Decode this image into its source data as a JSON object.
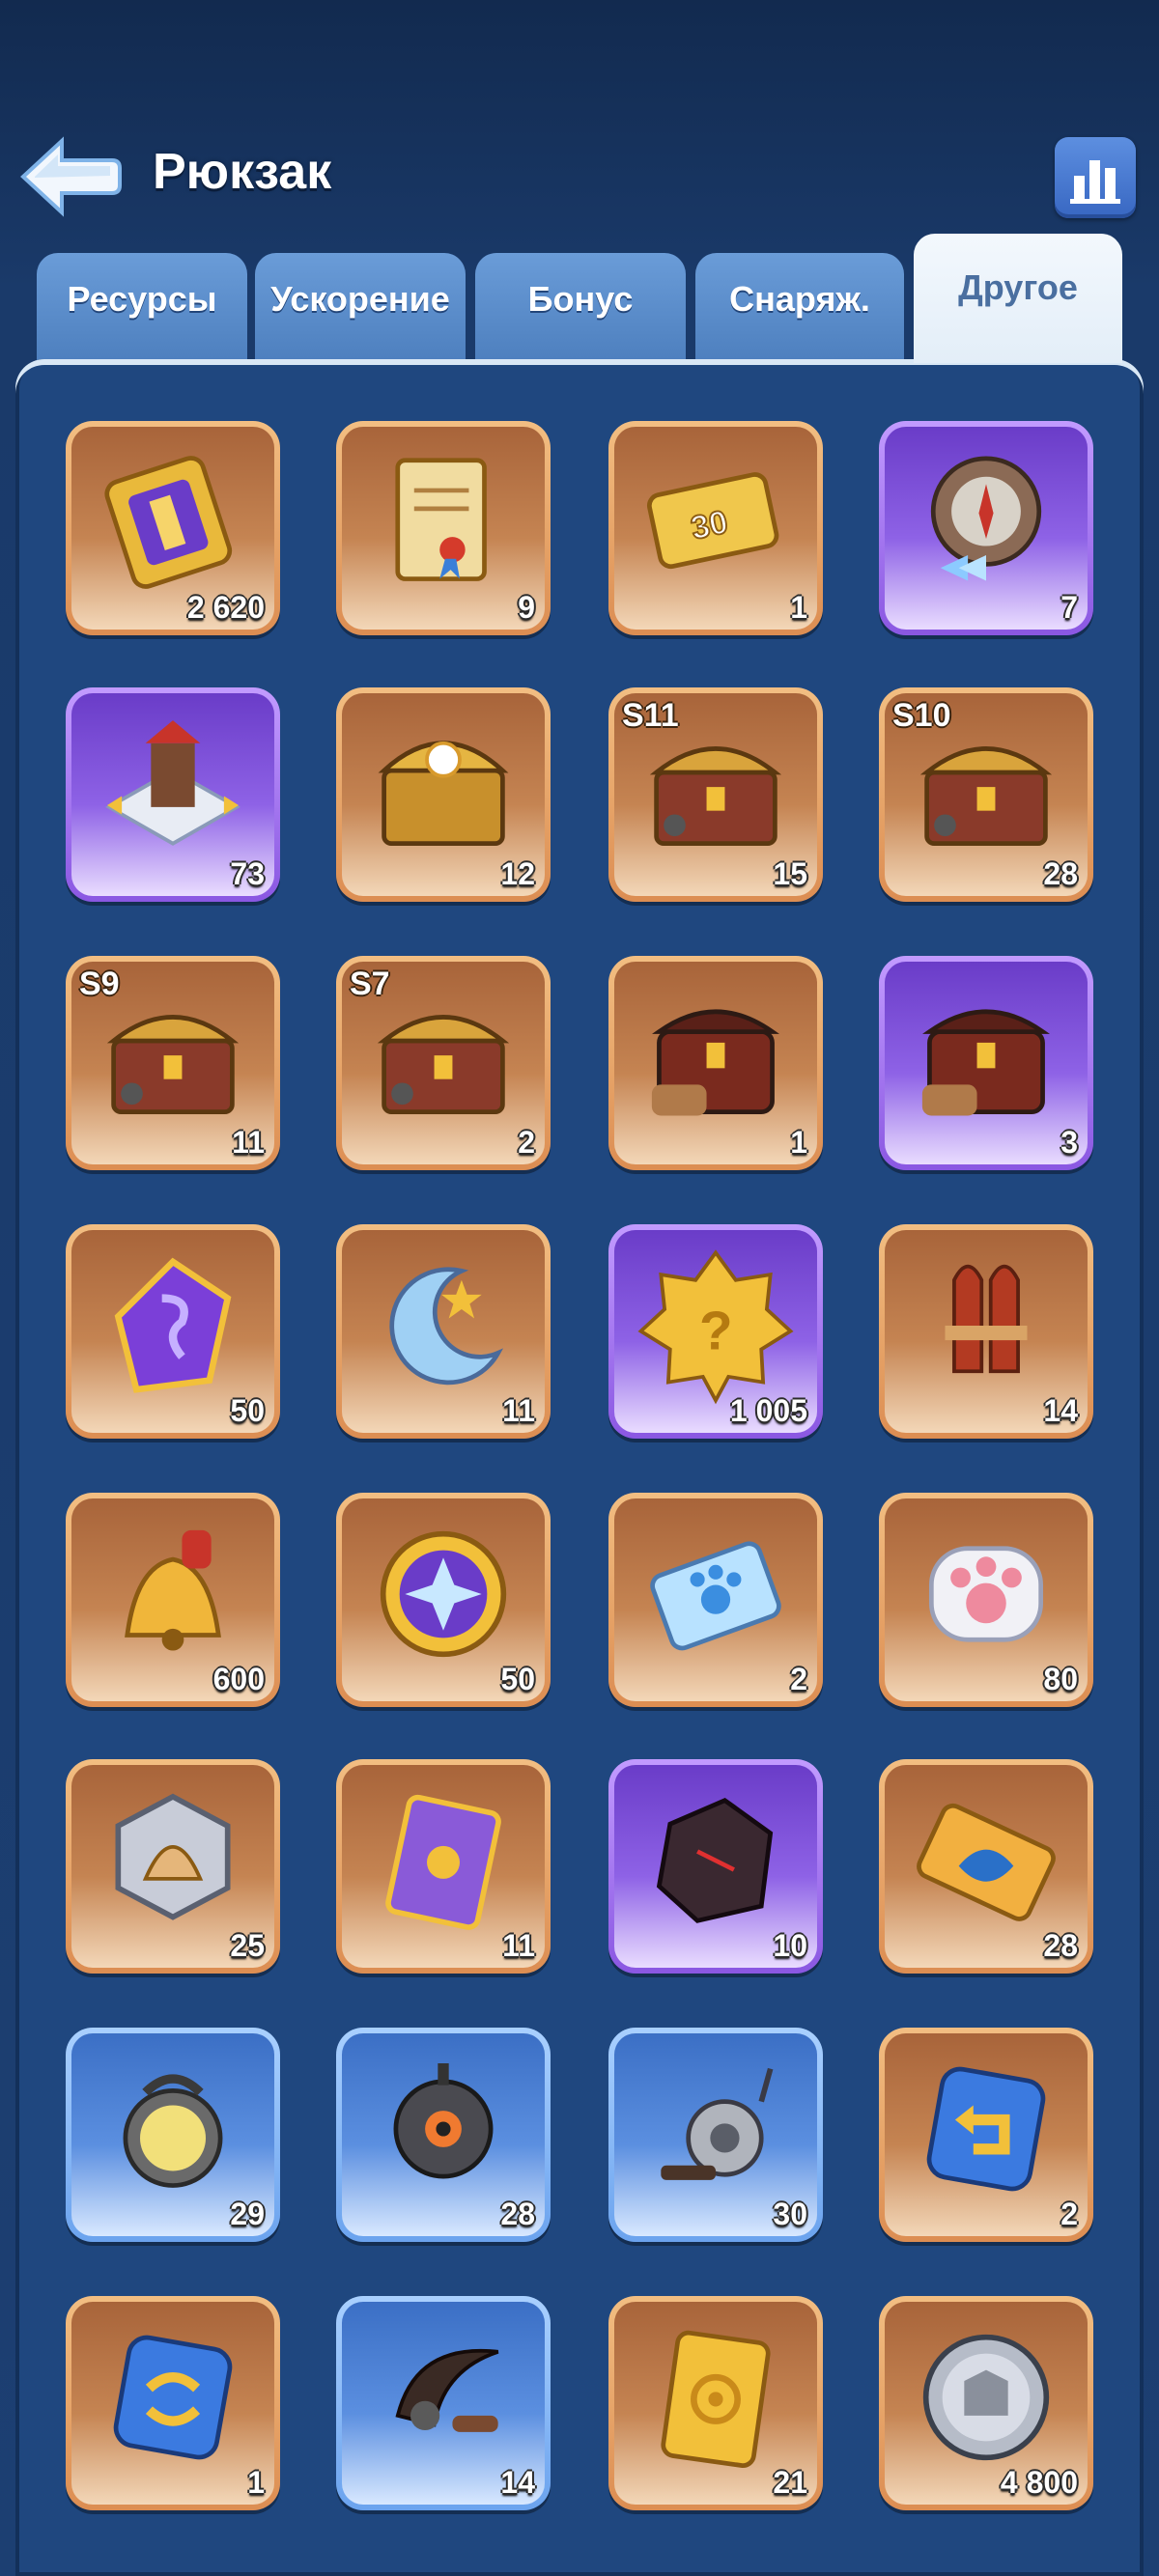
{
  "header": {
    "title": "Рюкзак",
    "back_icon": "back-arrow-icon",
    "stats_icon": "bar-chart-icon"
  },
  "tabs": [
    {
      "label": "Ресурсы",
      "active": false
    },
    {
      "label": "Ускорение",
      "active": false
    },
    {
      "label": "Бонус",
      "active": false
    },
    {
      "label": "Снаряж.",
      "active": false
    },
    {
      "label": "Другое",
      "active": true
    }
  ],
  "items": [
    {
      "name": "golden-ticket-icon",
      "count": "2 620",
      "rarity": "orange",
      "badge": ""
    },
    {
      "name": "scroll-icon",
      "count": "9",
      "rarity": "orange",
      "badge": ""
    },
    {
      "name": "coupon-30-icon",
      "count": "1",
      "rarity": "orange",
      "badge": ""
    },
    {
      "name": "compass-icon",
      "count": "7",
      "rarity": "purple",
      "badge": ""
    },
    {
      "name": "building-move-icon",
      "count": "73",
      "rarity": "purple",
      "badge": ""
    },
    {
      "name": "treasure-chest-icon",
      "count": "12",
      "rarity": "orange",
      "badge": ""
    },
    {
      "name": "season-chest-icon",
      "count": "15",
      "rarity": "orange",
      "badge": "S11"
    },
    {
      "name": "season-chest-icon",
      "count": "28",
      "rarity": "orange",
      "badge": "S10"
    },
    {
      "name": "season-chest-icon",
      "count": "11",
      "rarity": "orange",
      "badge": "S9"
    },
    {
      "name": "season-chest-icon",
      "count": "2",
      "rarity": "orange",
      "badge": "S7"
    },
    {
      "name": "gear-chest-icon",
      "count": "1",
      "rarity": "orange",
      "badge": ""
    },
    {
      "name": "gear-chest-icon",
      "count": "3",
      "rarity": "purple",
      "badge": ""
    },
    {
      "name": "purple-gem-icon",
      "count": "50",
      "rarity": "orange",
      "badge": ""
    },
    {
      "name": "moon-emblem-icon",
      "count": "11",
      "rarity": "orange",
      "badge": ""
    },
    {
      "name": "mystery-badge-icon",
      "count": "1 005",
      "rarity": "purple",
      "badge": ""
    },
    {
      "name": "rocket-icon",
      "count": "14",
      "rarity": "orange",
      "badge": ""
    },
    {
      "name": "bell-icon",
      "count": "600",
      "rarity": "orange",
      "badge": ""
    },
    {
      "name": "star-coin-icon",
      "count": "50",
      "rarity": "orange",
      "badge": ""
    },
    {
      "name": "paw-ticket-icon",
      "count": "2",
      "rarity": "orange",
      "badge": ""
    },
    {
      "name": "paw-token-icon",
      "count": "80",
      "rarity": "orange",
      "badge": ""
    },
    {
      "name": "shell-token-icon",
      "count": "25",
      "rarity": "orange",
      "badge": ""
    },
    {
      "name": "purple-card-icon",
      "count": "11",
      "rarity": "orange",
      "badge": ""
    },
    {
      "name": "dark-ore-icon",
      "count": "10",
      "rarity": "purple",
      "badge": ""
    },
    {
      "name": "fish-ticket-icon",
      "count": "28",
      "rarity": "orange",
      "badge": ""
    },
    {
      "name": "lamp-icon",
      "count": "29",
      "rarity": "blue",
      "badge": ""
    },
    {
      "name": "robot-icon",
      "count": "28",
      "rarity": "blue",
      "badge": ""
    },
    {
      "name": "fishing-reel-icon",
      "count": "30",
      "rarity": "blue",
      "badge": ""
    },
    {
      "name": "undo-icon",
      "count": "2",
      "rarity": "orange",
      "badge": ""
    },
    {
      "name": "swap-icon",
      "count": "1",
      "rarity": "orange",
      "badge": ""
    },
    {
      "name": "sickle-icon",
      "count": "14",
      "rarity": "blue",
      "badge": ""
    },
    {
      "name": "gold-ticket-target-icon",
      "count": "21",
      "rarity": "orange",
      "badge": ""
    },
    {
      "name": "silver-coin-icon",
      "count": "4 800",
      "rarity": "orange",
      "badge": ""
    }
  ]
}
